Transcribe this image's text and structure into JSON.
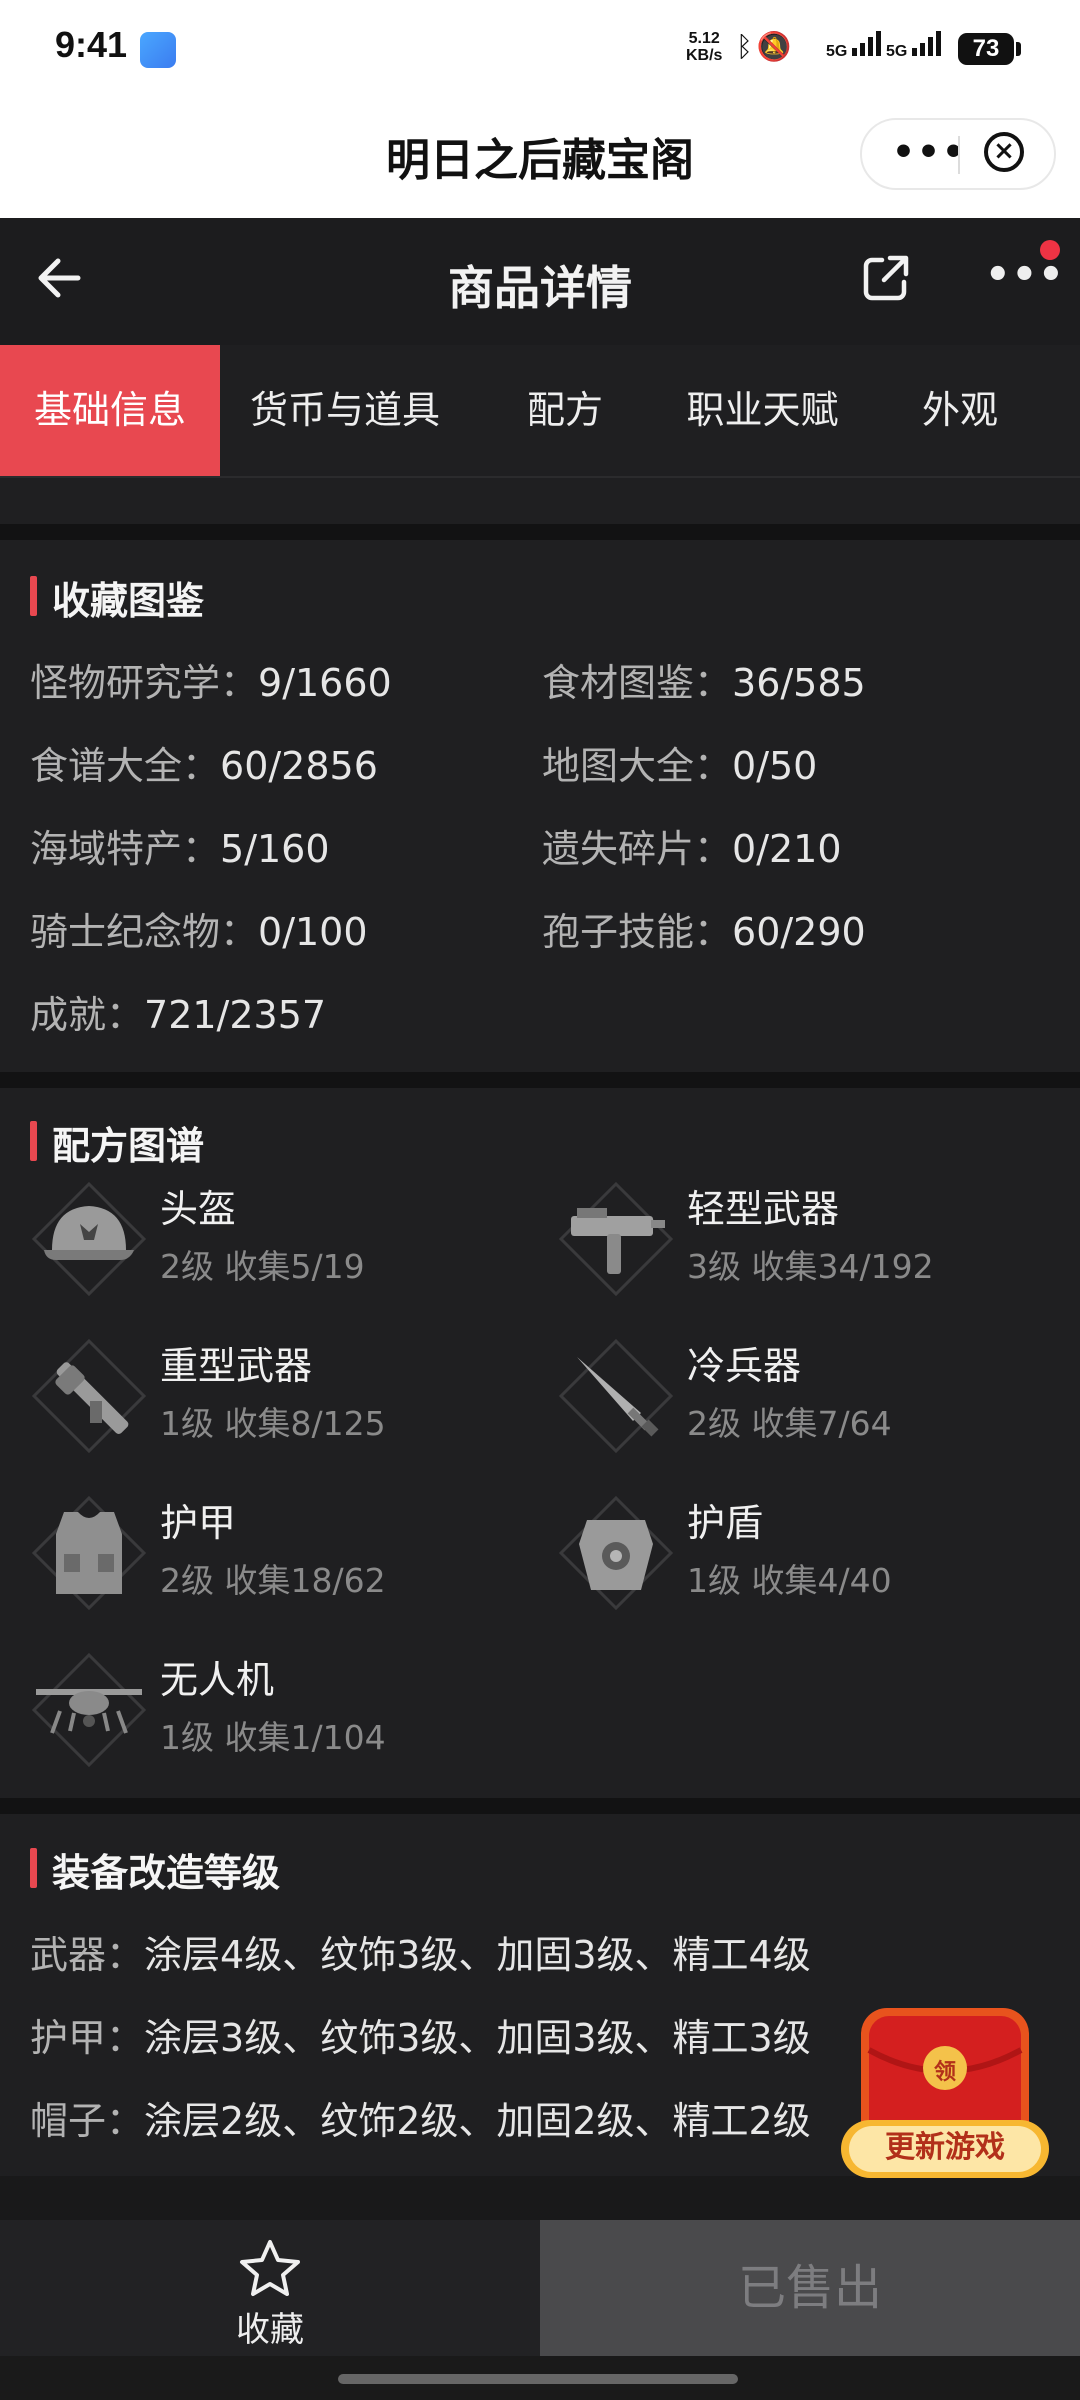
{
  "status_bar": {
    "time": "9:41",
    "net_speed_value": "5.12",
    "net_speed_unit": "KB/s",
    "net_label_1": "5G",
    "net_label_2": "5G",
    "battery": "73",
    "icons": [
      "app-icon",
      "bluetooth-icon",
      "mute-icon",
      "signal-icon",
      "signal-icon",
      "battery-icon"
    ]
  },
  "app": {
    "title": "明日之后藏宝阁"
  },
  "header": {
    "title": "商品详情"
  },
  "tabs": [
    {
      "label": "基础信息",
      "active": true
    },
    {
      "label": "货币与道具",
      "active": false
    },
    {
      "label": "配方",
      "active": false
    },
    {
      "label": "职业天赋",
      "active": false
    },
    {
      "label": "外观",
      "active": false
    }
  ],
  "collection": {
    "title": "收藏图鉴",
    "items": [
      {
        "key": "怪物研究学：",
        "value": "9/1660"
      },
      {
        "key": "食材图鉴：",
        "value": "36/585"
      },
      {
        "key": "食谱大全：",
        "value": "60/2856"
      },
      {
        "key": "地图大全：",
        "value": "0/50"
      },
      {
        "key": "海域特产：",
        "value": "5/160"
      },
      {
        "key": "遗失碎片：",
        "value": "0/210"
      },
      {
        "key": "骑士纪念物：",
        "value": "0/100"
      },
      {
        "key": "孢子技能：",
        "value": "60/290"
      },
      {
        "key": "成就：",
        "value": "721/2357"
      }
    ]
  },
  "recipes": {
    "title": "配方图谱",
    "items": [
      {
        "name": "头盔",
        "sub": "2级 收集5/19",
        "icon": "helmet-icon"
      },
      {
        "name": "轻型武器",
        "sub": "3级 收集34/192",
        "icon": "smg-icon"
      },
      {
        "name": "重型武器",
        "sub": "1级 收集8/125",
        "icon": "launcher-icon"
      },
      {
        "name": "冷兵器",
        "sub": "2级 收集7/64",
        "icon": "blade-icon"
      },
      {
        "name": "护甲",
        "sub": "2级 收集18/62",
        "icon": "vest-icon"
      },
      {
        "name": "护盾",
        "sub": "1级 收集4/40",
        "icon": "shield-armor-icon"
      },
      {
        "name": "无人机",
        "sub": "1级 收集1/104",
        "icon": "drone-icon"
      }
    ]
  },
  "mods": {
    "title": "装备改造等级",
    "items": [
      {
        "key": "武器：",
        "value": "涂层4级、纹饰3级、加固3级、精工4级"
      },
      {
        "key": "护甲：",
        "value": "涂层3级、纹饰3级、加固3级、精工3级"
      },
      {
        "key": "帽子：",
        "value": "涂层2级、纹饰2级、加固2级、精工2级"
      }
    ]
  },
  "red_packet": {
    "glyph": "领",
    "label": "更新游戏"
  },
  "bottom": {
    "fav_label": "收藏",
    "sold_label": "已售出"
  },
  "colors": {
    "accent": "#e84850",
    "background": "#1f1f21",
    "sold_button": "#4a4a4c"
  }
}
